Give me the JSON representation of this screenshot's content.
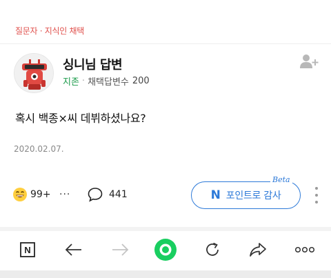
{
  "header": {
    "breadcrumb": "질문자 · 지식인 채택"
  },
  "answer": {
    "title": "싱니님 답변",
    "grade": "지존",
    "separator": "·",
    "stat_label": "채택답변수",
    "stat_value": "200"
  },
  "content": {
    "text": "혹시 백종×씨 데뷔하셨나요?",
    "date": "2020.02.07."
  },
  "actions": {
    "like_count": "99+",
    "more": "···",
    "comment_count": "441",
    "point_button_mark": "N",
    "point_button_label": "포인트로 감사",
    "beta_label": "Beta"
  },
  "icons": {
    "add_friend": "add-friend-icon",
    "like": "smile-emoji-icon",
    "comment": "speech-bubble-icon",
    "kebab": "vertical-dots-icon",
    "nav_home": "naver-n-icon",
    "back": "arrow-left-icon",
    "forward": "arrow-right-icon",
    "green_dot": "green-circle-icon",
    "reload": "reload-icon",
    "share": "share-icon",
    "more": "more-horizontal-icon"
  },
  "toolbar": {
    "home_letter": "N"
  },
  "colors": {
    "accent_red": "#e0514d",
    "accent_green": "#1a9b4a",
    "accent_blue": "#2c79d8",
    "green_button": "#19ce60"
  }
}
